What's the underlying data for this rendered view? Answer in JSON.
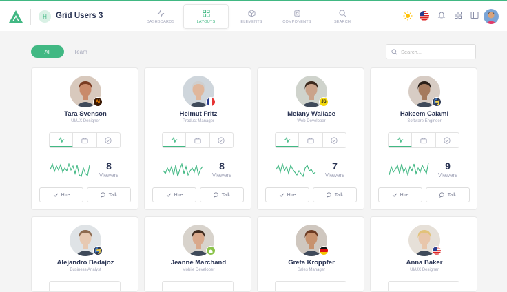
{
  "app": {
    "title": "Grid Users 3",
    "badge_letter": "H",
    "accent": "#41b883"
  },
  "nav": {
    "tabs": [
      {
        "label": "DASHBOARDS",
        "icon": "activity-icon",
        "active": false
      },
      {
        "label": "LAYOUTS",
        "icon": "grid-icon",
        "active": true
      },
      {
        "label": "ELEMENTS",
        "icon": "box-icon",
        "active": false
      },
      {
        "label": "COMPONENTS",
        "icon": "cpu-icon",
        "active": false
      },
      {
        "label": "SEARCH",
        "icon": "search-icon",
        "active": false
      }
    ]
  },
  "toolbar": {
    "icons": [
      "sun-icon",
      "us-flag-icon",
      "bell-icon",
      "apps-grid-icon",
      "sidebar-icon",
      "user-avatar"
    ]
  },
  "filters": {
    "all": "All",
    "team": "Team",
    "active": "All"
  },
  "search": {
    "placeholder": "Search..."
  },
  "users": [
    {
      "name": "Tara Svenson",
      "role": "UI/UX Designer",
      "badge": "Ai",
      "viewers": "8",
      "viewers_label": "Viewers",
      "hire": "Hire",
      "talk": "Talk"
    },
    {
      "name": "Helmut Fritz",
      "role": "Product Manager",
      "badge": "fr-flag",
      "viewers": "8",
      "viewers_label": "Viewers",
      "hire": "Hire",
      "talk": "Talk"
    },
    {
      "name": "Melany Wallace",
      "role": "Web Developer",
      "badge": "JS",
      "viewers": "7",
      "viewers_label": "Viewers",
      "hire": "Hire",
      "talk": "Talk"
    },
    {
      "name": "Hakeem Calami",
      "role": "Software Engineer",
      "badge": "python",
      "viewers": "9",
      "viewers_label": "Viewers",
      "hire": "Hire",
      "talk": "Talk"
    },
    {
      "name": "Alejandro Badajoz",
      "role": "Business Analyst",
      "badge": "python",
      "viewers": "",
      "viewers_label": "",
      "hire": "",
      "talk": ""
    },
    {
      "name": "Jeanne Marchand",
      "role": "Mobile Developer",
      "badge": "android",
      "viewers": "",
      "viewers_label": "",
      "hire": "",
      "talk": ""
    },
    {
      "name": "Greta Kroppfer",
      "role": "Sales Manager",
      "badge": "de-flag",
      "viewers": "",
      "viewers_label": "",
      "hire": "",
      "talk": ""
    },
    {
      "name": "Anna Baker",
      "role": "UI/UX Designer",
      "badge": "us-flag",
      "viewers": "",
      "viewers_label": "",
      "hire": "",
      "talk": ""
    }
  ]
}
